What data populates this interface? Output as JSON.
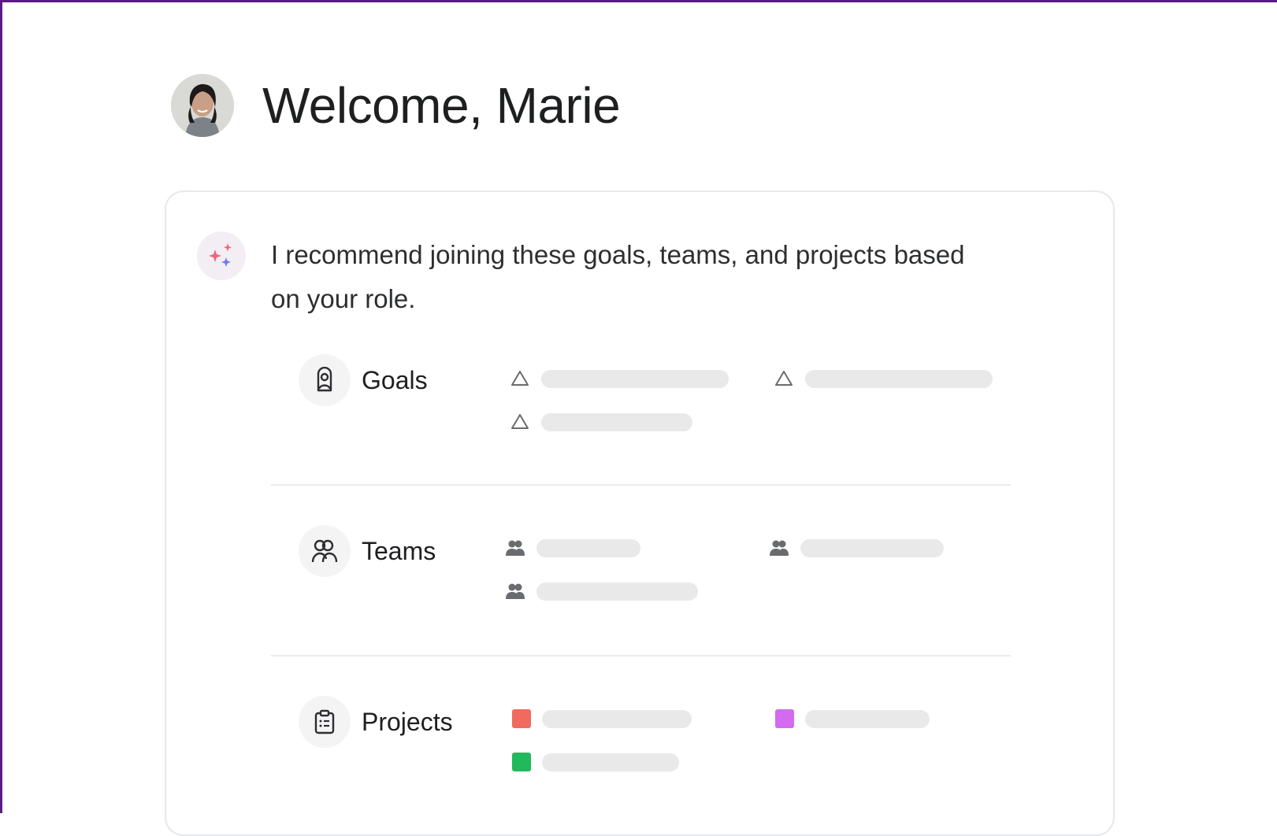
{
  "header": {
    "title": "Welcome, Marie"
  },
  "message": {
    "text": "I recommend joining these goals, teams, and projects based on your role."
  },
  "sections": [
    {
      "label": "Goals",
      "icon": "goal-icon",
      "item_icon": "triangle-outline-icon",
      "items": [
        {
          "bar_fill": 0.62
        },
        {
          "bar_fill": 0.62
        },
        {
          "bar_fill": 0.5
        }
      ]
    },
    {
      "label": "Teams",
      "icon": "team-icon",
      "item_icon": "team-member-icon",
      "items": [
        {
          "bar_fill": 0.34
        },
        {
          "bar_fill": 0.47
        },
        {
          "bar_fill": 0.53
        }
      ]
    },
    {
      "label": "Projects",
      "icon": "clipboard-icon",
      "item_icon": "color-swatch",
      "items": [
        {
          "color": "#f06a5f",
          "bar_fill": 0.49
        },
        {
          "color": "#d36af0",
          "bar_fill": 0.41
        },
        {
          "color": "#21b95c",
          "bar_fill": 0.45
        }
      ]
    }
  ],
  "colors": {
    "frame": "#5b1a86",
    "text": "#1e1f21",
    "placeholder_bar": "#e9e9ea",
    "divider": "#e8eaf0",
    "sparkle_pink": "#f0637a",
    "sparkle_blue": "#6a7cf0"
  }
}
